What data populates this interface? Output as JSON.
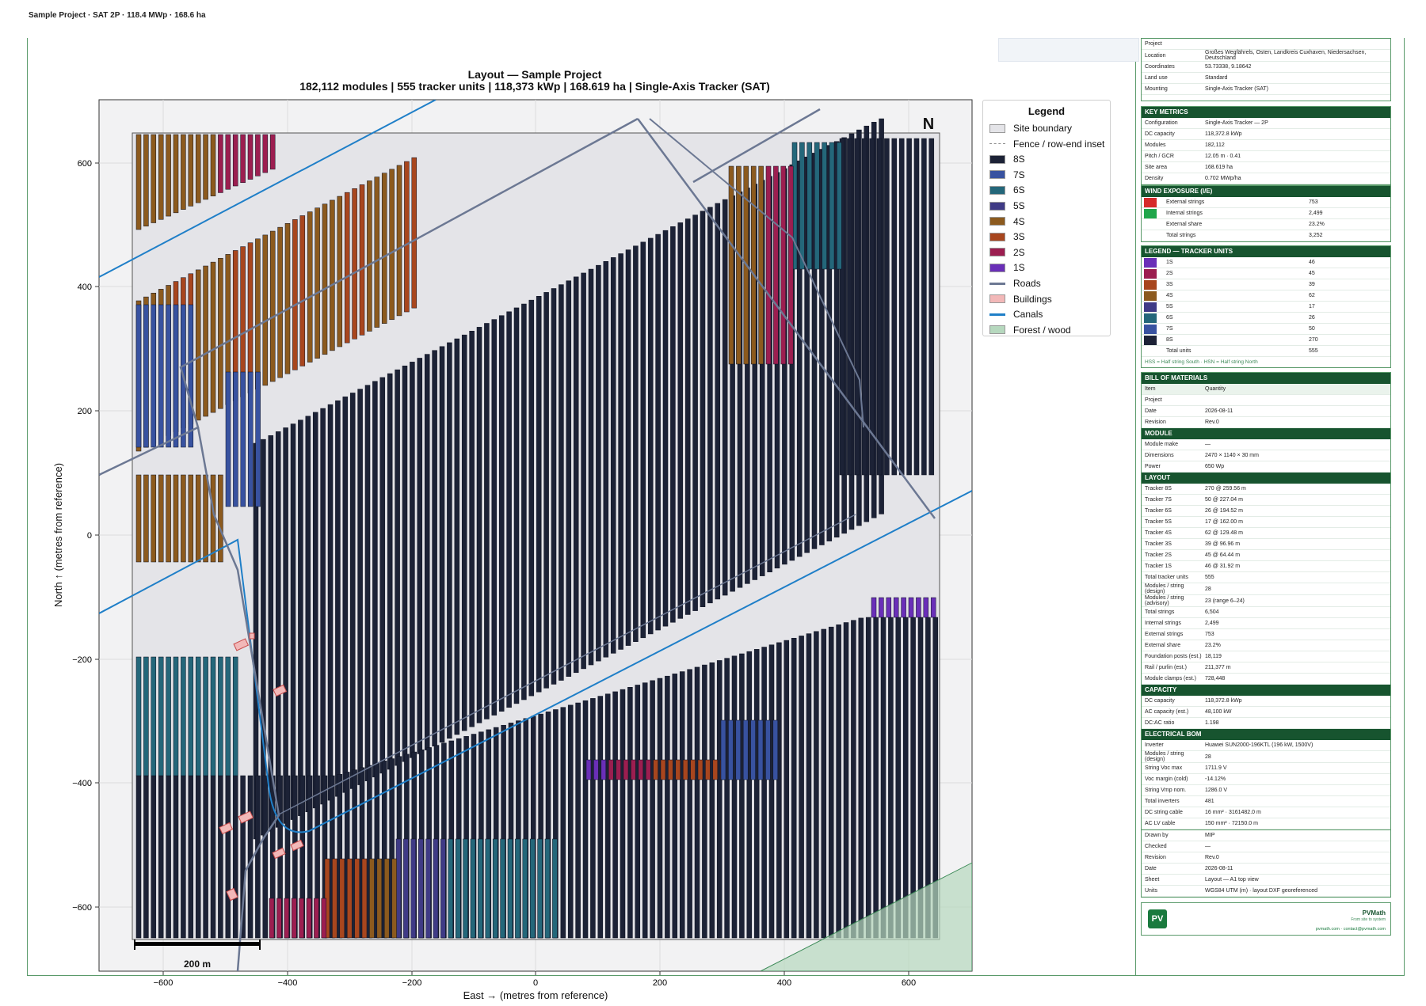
{
  "topbar": "Sample Project  ·  SAT 2P  ·  118.4 MWp  ·  168.6 ha",
  "chart": {
    "title": "Layout — Sample Project",
    "subtitle": "182,112 modules  |  555 tracker units  |  118,373 kWp  |  168.619 ha  |  Single-Axis Tracker (SAT)",
    "xlabel": "East →  (metres from reference)",
    "ylabel": "North ↑  (metres from reference)",
    "xticks": [
      "−600",
      "−400",
      "−200",
      "0",
      "200",
      "400",
      "600"
    ],
    "yticks": [
      "600",
      "400",
      "200",
      "0",
      "−200",
      "−400",
      "−600"
    ],
    "north": "N",
    "scale": "200 m"
  },
  "legend": {
    "title": "Legend",
    "items": [
      {
        "label": "Site boundary",
        "color": "#e4e4e8",
        "kind": "box"
      },
      {
        "label": "Fence / row-end inset",
        "color": "#8d8d8d",
        "kind": "dash"
      },
      {
        "label": "8S",
        "color": "#1c2236",
        "kind": "box"
      },
      {
        "label": "7S",
        "color": "#3852a0",
        "kind": "box"
      },
      {
        "label": "6S",
        "color": "#24677a",
        "kind": "box"
      },
      {
        "label": "5S",
        "color": "#3f3a86",
        "kind": "box"
      },
      {
        "label": "4S",
        "color": "#8c5a1e",
        "kind": "box"
      },
      {
        "label": "3S",
        "color": "#a8461e",
        "kind": "box"
      },
      {
        "label": "2S",
        "color": "#9c1e50",
        "kind": "box"
      },
      {
        "label": "1S",
        "color": "#6a2fb8",
        "kind": "box"
      },
      {
        "label": "Roads",
        "color": "#6c7893",
        "kind": "line"
      },
      {
        "label": "Buildings",
        "color": "#f2b8b8",
        "kind": "box"
      },
      {
        "label": "Canals",
        "color": "#1f7fc8",
        "kind": "line"
      },
      {
        "label": "Forest / wood",
        "color": "#b6d8be",
        "kind": "box"
      }
    ]
  },
  "sidebar": {
    "project": [
      {
        "k": "Project",
        "v": ""
      },
      {
        "k": "Location",
        "v": "Großes Wegfährels, Osten, Landkreis Cuxhaven, Niedersachsen, Deutschland"
      },
      {
        "k": "Coordinates",
        "v": "53.73338, 9.18642"
      },
      {
        "k": "Land use",
        "v": "Standard"
      },
      {
        "k": "Mounting",
        "v": "Single-Axis Tracker (SAT)"
      }
    ],
    "key_metrics_title": "KEY METRICS",
    "key_metrics": [
      {
        "k": "Configuration",
        "v": "Single-Axis Tracker — 2P"
      },
      {
        "k": "DC capacity",
        "v": "118,372.8 kWp"
      },
      {
        "k": "Modules",
        "v": "182,112"
      },
      {
        "k": "Pitch / GCR",
        "v": "12.05 m · 0.41"
      },
      {
        "k": "Site area",
        "v": "168.619 ha"
      },
      {
        "k": "Density",
        "v": "0.702 MWp/ha"
      }
    ],
    "wind_title": "WIND EXPOSURE (I/E)",
    "wind": [
      {
        "k": "External strings",
        "v": "753",
        "color": "#d62b2b"
      },
      {
        "k": "Internal strings",
        "v": "2,499",
        "color": "#1fa64a"
      },
      {
        "k": "External share",
        "v": "23.2%",
        "color": ""
      },
      {
        "k": "Total strings",
        "v": "3,252",
        "color": ""
      }
    ],
    "units_title": "LEGEND — TRACKER UNITS",
    "units": [
      {
        "k": "1S",
        "v": "46",
        "color": "#6a2fb8"
      },
      {
        "k": "2S",
        "v": "45",
        "color": "#9c1e50"
      },
      {
        "k": "3S",
        "v": "39",
        "color": "#a8461e"
      },
      {
        "k": "4S",
        "v": "62",
        "color": "#8c5a1e"
      },
      {
        "k": "5S",
        "v": "17",
        "color": "#3f3a86"
      },
      {
        "k": "6S",
        "v": "26",
        "color": "#24677a"
      },
      {
        "k": "7S",
        "v": "50",
        "color": "#3852a0"
      },
      {
        "k": "8S",
        "v": "270",
        "color": "#1c2236"
      },
      {
        "k": "Total units",
        "v": "555",
        "color": ""
      }
    ],
    "units_note": "HSS = Half string South · HSN = Half string North",
    "bom_title": "BILL OF MATERIALS",
    "bom_head": {
      "k": "Item",
      "v": "Quantity"
    },
    "bom": [
      {
        "k": "Project",
        "v": ""
      },
      {
        "k": "Date",
        "v": "2026-08-11"
      },
      {
        "k": "Revision",
        "v": "Rev.0"
      }
    ],
    "module_title": "MODULE",
    "module": [
      {
        "k": "Module make",
        "v": "—"
      },
      {
        "k": "Dimensions",
        "v": "2470 × 1140 × 30 mm"
      },
      {
        "k": "Power",
        "v": "650 Wp"
      }
    ],
    "layout_title": "LAYOUT",
    "layout": [
      {
        "k": "Tracker 8S",
        "v": "270 @ 259.56 m"
      },
      {
        "k": "Tracker 7S",
        "v": "50 @ 227.04 m"
      },
      {
        "k": "Tracker 6S",
        "v": "26 @ 194.52 m"
      },
      {
        "k": "Tracker 5S",
        "v": "17 @ 162.00 m"
      },
      {
        "k": "Tracker 4S",
        "v": "62 @ 129.48 m"
      },
      {
        "k": "Tracker 3S",
        "v": "39 @ 96.96 m"
      },
      {
        "k": "Tracker 2S",
        "v": "45 @ 64.44 m"
      },
      {
        "k": "Tracker 1S",
        "v": "46 @ 31.92 m"
      },
      {
        "k": "Total tracker units",
        "v": "555"
      },
      {
        "k": "Modules / string (design)",
        "v": "28"
      },
      {
        "k": "Modules / string (advisory)",
        "v": "23 (range 6–24)"
      },
      {
        "k": "Total strings",
        "v": "6,504"
      },
      {
        "k": "Internal strings",
        "v": "2,499"
      },
      {
        "k": "External strings",
        "v": "753"
      },
      {
        "k": "External share",
        "v": "23.2%"
      },
      {
        "k": "Foundation posts (est.)",
        "v": "18,119"
      },
      {
        "k": "Rail / purlin (est.)",
        "v": "211,377 m"
      },
      {
        "k": "Module clamps (est.)",
        "v": "728,448"
      }
    ],
    "capacity_title": "CAPACITY",
    "capacity": [
      {
        "k": "DC capacity",
        "v": "118,372.8 kWp"
      },
      {
        "k": "AC capacity (est.)",
        "v": "48,100 kW"
      },
      {
        "k": "DC:AC ratio",
        "v": "1.198"
      }
    ],
    "elec_title": "ELECTRICAL BOM",
    "elec": [
      {
        "k": "Inverter",
        "v": "Huawei SUN2000-196KTL (196 kW, 1500V)"
      },
      {
        "k": "Modules / string (design)",
        "v": "28"
      },
      {
        "k": "String Voc max",
        "v": "1711.9 V"
      },
      {
        "k": "Voc margin (cold)",
        "v": "-14.12%"
      },
      {
        "k": "String Vmp nom.",
        "v": "1286.0 V"
      },
      {
        "k": "Total inverters",
        "v": "481"
      },
      {
        "k": "DC string cable",
        "v": "16 mm² · 3161482.0 m"
      },
      {
        "k": "AC LV cable",
        "v": "150 mm² · 72150.0 m"
      }
    ],
    "titleblock": [
      {
        "k": "Drawn by",
        "v": "MIP"
      },
      {
        "k": "Checked",
        "v": "—"
      },
      {
        "k": "Revision",
        "v": "Rev.0"
      },
      {
        "k": "Date",
        "v": "2026-08-11"
      },
      {
        "k": "Sheet",
        "v": "Layout — A1 top view"
      },
      {
        "k": "Units",
        "v": "WGS84 UTM (m) · layout DXF georeferenced"
      }
    ],
    "logo_text": "PV",
    "brand": "PVMath",
    "brand_tag": "From site to system",
    "brand_url": "pvmath.com · contact@pvmath.com"
  }
}
